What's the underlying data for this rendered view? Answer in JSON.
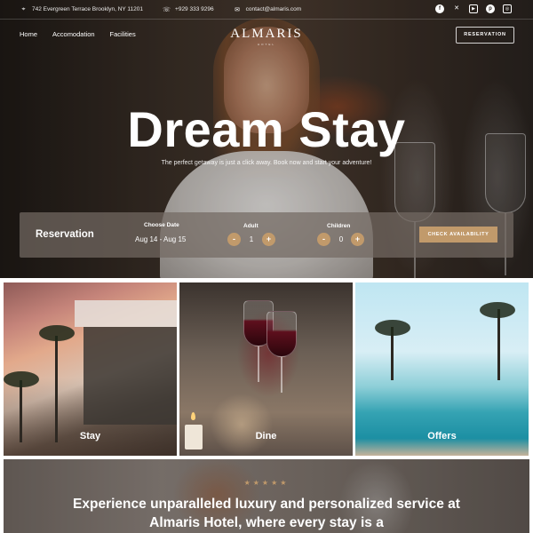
{
  "topbar": {
    "address": "742 Evergreen Terrace Brooklyn, NY 11201",
    "phone": "+929 333 9296",
    "email": "contact@almaris.com",
    "address_icon": "map-pin-icon",
    "phone_icon": "phone-icon",
    "email_icon": "envelope-icon",
    "socials": [
      "facebook-icon",
      "x-icon",
      "youtube-icon",
      "pinterest-icon",
      "instagram-icon"
    ]
  },
  "nav": {
    "links": [
      "Home",
      "Accomodation",
      "Facilities"
    ],
    "logo": "ALMARIS",
    "logo_sub": "HOTEL",
    "reservation_button": "RESERVATION"
  },
  "hero": {
    "title": "Dream Stay",
    "subtitle": "The perfect getaway is just a click away. Book now and start your adventure!"
  },
  "reservation": {
    "title": "Reservation",
    "date_label": "Choose Date",
    "date_value": "Aug 14 - Aug 15",
    "adult_label": "Adult",
    "adult_value": "1",
    "children_label": "Children",
    "children_value": "0",
    "minus": "-",
    "plus": "+",
    "check_button": "CHECK AVAILABILITY",
    "accent_color": "#c19a6b"
  },
  "cards": [
    {
      "label": "Stay"
    },
    {
      "label": "Dine"
    },
    {
      "label": "Offers"
    }
  ],
  "testimonial": {
    "stars": "★★★★★",
    "text": "Experience unparalleled luxury and personalized service at Almaris Hotel, where every stay is a"
  }
}
